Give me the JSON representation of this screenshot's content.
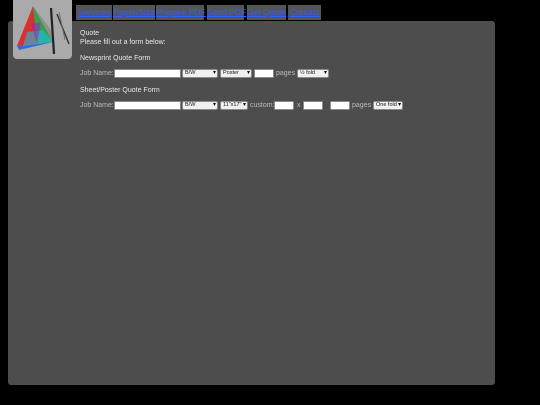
{
  "nav": {
    "items": [
      {
        "label": "Services"
      },
      {
        "label": "Paper/Size"
      },
      {
        "label": "Prepare PDF"
      },
      {
        "label": "Send PDF"
      },
      {
        "label": "Get Quote"
      },
      {
        "label": "Contact"
      }
    ],
    "link_color": "#2f5fff"
  },
  "logo": {
    "icon": "triangle-prism-logo"
  },
  "main": {
    "title": "Quote",
    "intro": "Please fill out a form below:"
  },
  "newsprint": {
    "heading": "Newsprint Quote Form",
    "job_label": "Job Name:",
    "job_value": "",
    "color_select": "B/W",
    "type_select": "Poster",
    "pages_value": "",
    "pages_label": "pages",
    "fold_select": "½ fold"
  },
  "sheet": {
    "heading": "Sheet/Poster Quote Form",
    "job_label": "Job Name:",
    "job_value": "",
    "color_select": "B/W",
    "size_select": "11\"x17\"",
    "custom_label": "custom:",
    "width_value": "",
    "x_label": "x",
    "height_value": "",
    "qty_value": "",
    "pages_label": "pages",
    "fold_select": "One fold"
  },
  "colors": {
    "page_bg": "#000000",
    "panel_bg": "#4d4d4d",
    "nav_bg": "#555555",
    "logo_bg": "#aaaaaa"
  }
}
